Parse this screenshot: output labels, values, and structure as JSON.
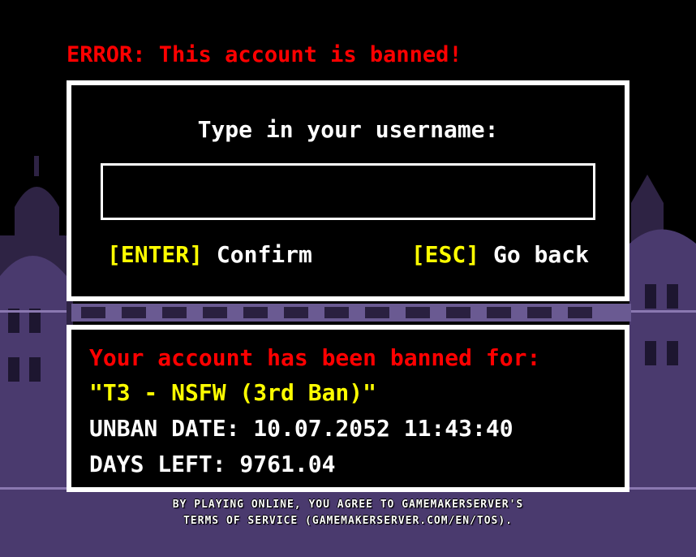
{
  "error_title": "ERROR: This account is banned!",
  "login": {
    "prompt": "Type in your username:",
    "username_value": "",
    "confirm_key": "[ENTER]",
    "confirm_label": "Confirm",
    "back_key": "[ESC]",
    "back_label": "Go back"
  },
  "ban": {
    "heading": "Your account has been banned for:",
    "reason": "\"T3 - NSFW (3rd Ban)\"",
    "unban_date": "UNBAN DATE: 10.07.2052 11:43:40",
    "days_left": "DAYS LEFT: 9761.04"
  },
  "tos": {
    "line1": "BY PLAYING ONLINE, YOU AGREE TO GAMEMAKERSERVER'S",
    "line2": "TERMS OF SERVICE (GAMEMAKERSERVER.COM/EN/TOS)."
  },
  "colors": {
    "error_red": "#ff0000",
    "key_yellow": "#ffff00",
    "text_white": "#ffffff",
    "background": "#000000",
    "castle_purple": "#4a3a6e"
  }
}
